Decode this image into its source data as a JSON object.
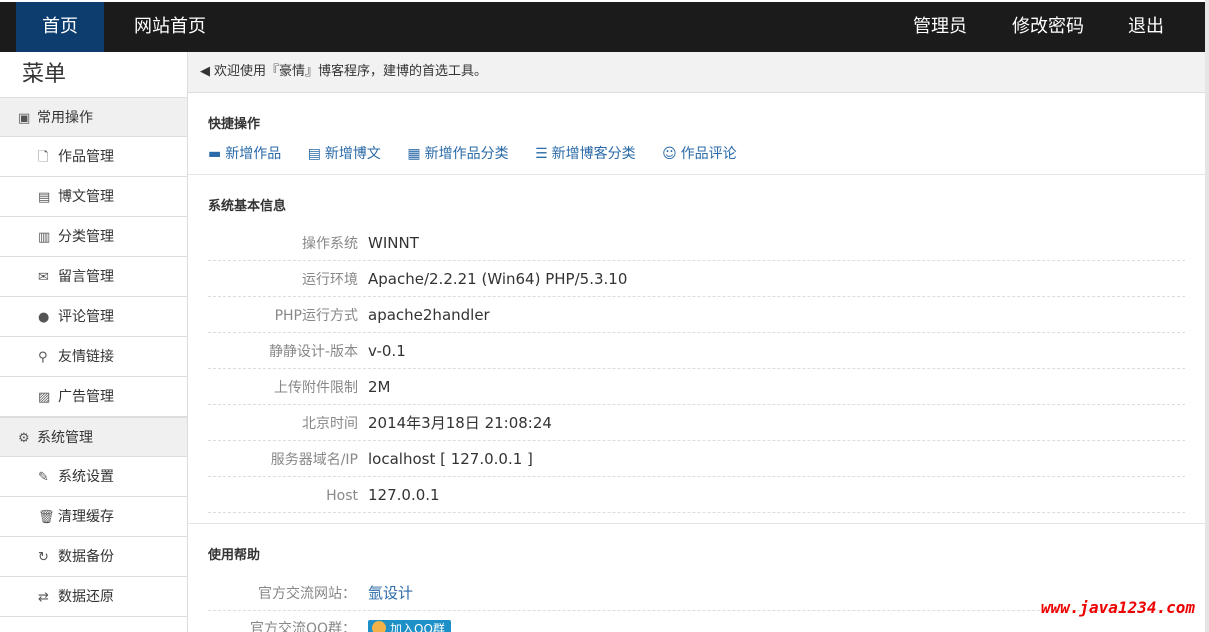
{
  "navbar": {
    "home": "首页",
    "site_home": "网站首页",
    "admin": "管理员",
    "change_password": "修改密码",
    "logout": "退出"
  },
  "sidebar": {
    "title": "菜单",
    "groups": [
      {
        "label": "常用操作",
        "icon": "dashboard-icon",
        "items": [
          {
            "label": "作品管理",
            "icon": "file-icon"
          },
          {
            "label": "博文管理",
            "icon": "document-icon"
          },
          {
            "label": "分类管理",
            "icon": "books-icon"
          },
          {
            "label": "留言管理",
            "icon": "envelope-icon"
          },
          {
            "label": "评论管理",
            "icon": "comment-icon"
          },
          {
            "label": "友情链接",
            "icon": "link-icon"
          },
          {
            "label": "广告管理",
            "icon": "picture-icon"
          }
        ]
      },
      {
        "label": "系统管理",
        "icon": "gear-icon",
        "items": [
          {
            "label": "系统设置",
            "icon": "wrench-icon"
          },
          {
            "label": "清理缓存",
            "icon": "trash-icon"
          },
          {
            "label": "数据备份",
            "icon": "backup-icon"
          },
          {
            "label": "数据还原",
            "icon": "restore-icon"
          }
        ]
      }
    ]
  },
  "notice": {
    "icon": "speaker-icon",
    "text": "欢迎使用『豪情』博客程序，建博的首选工具。"
  },
  "quick_ops": {
    "title": "快捷操作",
    "links": [
      {
        "label": "新增作品",
        "icon": "card-icon"
      },
      {
        "label": "新增博文",
        "icon": "document-icon"
      },
      {
        "label": "新增作品分类",
        "icon": "list-box-icon"
      },
      {
        "label": "新增博客分类",
        "icon": "list-icon"
      },
      {
        "label": "作品评论",
        "icon": "smile-icon"
      }
    ]
  },
  "sysinfo": {
    "title": "系统基本信息",
    "rows": [
      {
        "label": "操作系统",
        "value": "WINNT"
      },
      {
        "label": "运行环境",
        "value": "Apache/2.2.21 (Win64) PHP/5.3.10"
      },
      {
        "label": "PHP运行方式",
        "value": "apache2handler"
      },
      {
        "label": "静静设计-版本",
        "value": "v-0.1"
      },
      {
        "label": "上传附件限制",
        "value": "2M"
      },
      {
        "label": "北京时间",
        "value": "2014年3月18日 21:08:24"
      },
      {
        "label": "服务器域名/IP",
        "value": "localhost [ 127.0.0.1 ]"
      },
      {
        "label": "Host",
        "value": "127.0.0.1"
      }
    ]
  },
  "help": {
    "title": "使用帮助",
    "site_label": "官方交流网站：",
    "site_value": "氩设计",
    "qq_label": "官方交流QQ群：",
    "qq_button": "加入QQ群"
  },
  "watermark": "www.java1234.com",
  "colors": {
    "navbar_bg": "#1b1b1b",
    "nav_active": "#0d3c6e",
    "link": "#2a6aa8",
    "watermark": "#ee0000"
  }
}
